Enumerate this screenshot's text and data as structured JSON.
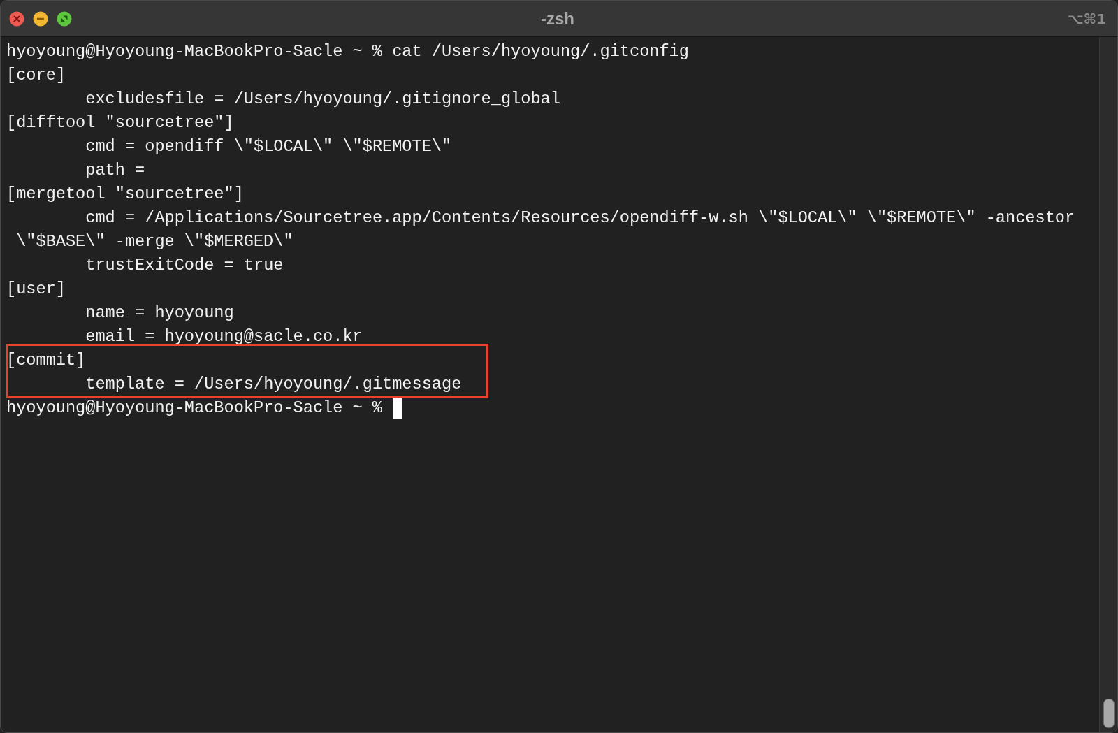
{
  "window": {
    "title": "-zsh",
    "shortcut": "⌥⌘1"
  },
  "lines": [
    "hyoyoung@Hyoyoung-MacBookPro-Sacle ~ % cat /Users/hyoyoung/.gitconfig",
    "[core]",
    "\texcludesfile = /Users/hyoyoung/.gitignore_global",
    "[difftool \"sourcetree\"]",
    "\tcmd = opendiff \\\"$LOCAL\\\" \\\"$REMOTE\\\"",
    "\tpath =",
    "[mergetool \"sourcetree\"]",
    "\tcmd = /Applications/Sourcetree.app/Contents/Resources/opendiff-w.sh \\\"$LOCAL\\\" \\\"$REMOTE\\\" -ancestor",
    " \\\"$BASE\\\" -merge \\\"$MERGED\\\"",
    "\ttrustExitCode = true",
    "[user]",
    "\tname = hyoyoung",
    "\temail = hyoyoung@sacle.co.kr"
  ],
  "highlighted_block": {
    "lines": [
      "[commit]",
      "\ttemplate = /Users/hyoyoung/.gitmessage"
    ]
  },
  "prompt": {
    "text": "hyoyoung@Hyoyoung-MacBookPro-Sacle ~ %",
    "cursor": true
  }
}
